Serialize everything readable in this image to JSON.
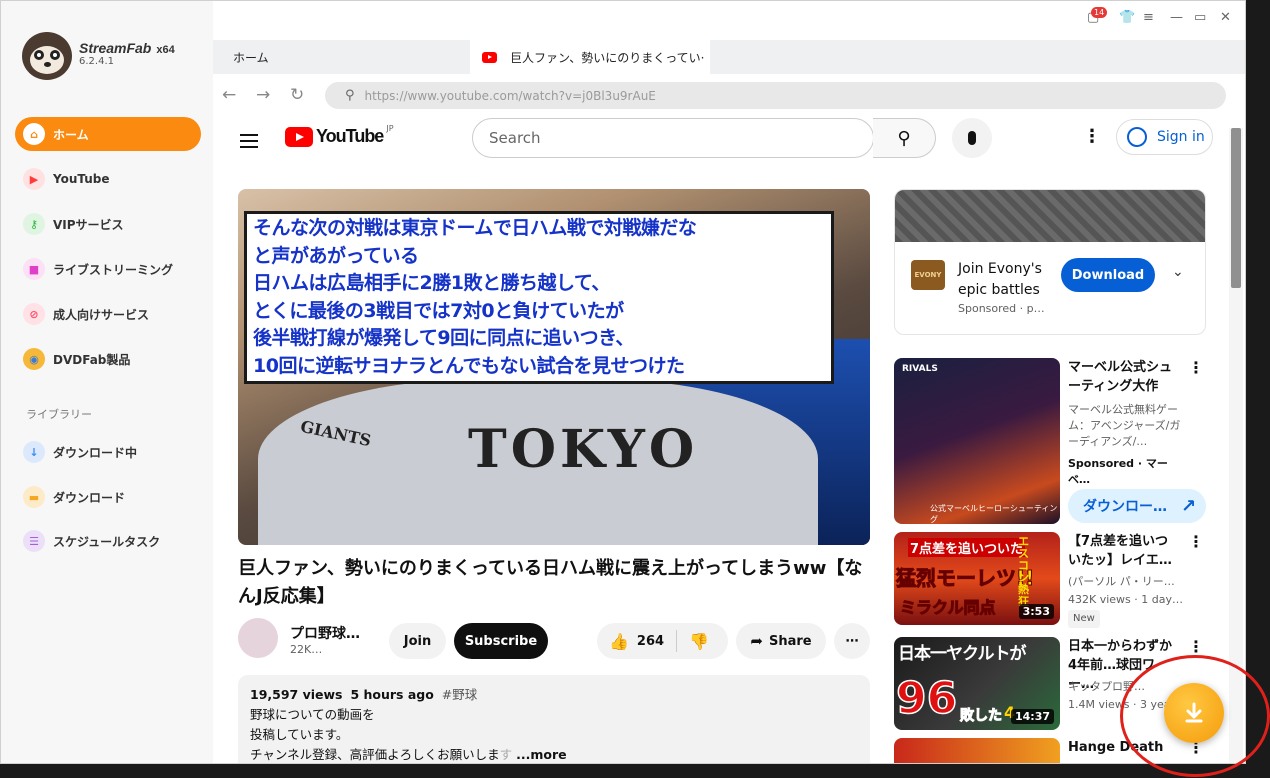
{
  "app": {
    "name": "StreamFab",
    "arch": "x64",
    "version": "6.2.4.1",
    "notif_count": "14"
  },
  "sidebar": {
    "items": [
      {
        "label": "ホーム",
        "icon": "home-icon",
        "color": "#fa8a10",
        "active": true
      },
      {
        "label": "YouTube",
        "icon": "youtube-icon",
        "color": "#ff5a5a"
      },
      {
        "label": "VIPサービス",
        "icon": "key-icon",
        "color": "#3cc24a"
      },
      {
        "label": "ライブストリーミング",
        "icon": "camera-icon",
        "color": "#e040c8"
      },
      {
        "label": "成人向けサービス",
        "icon": "adult-icon",
        "color": "#ff4f6a"
      },
      {
        "label": "DVDFab製品",
        "icon": "dvdfab-icon",
        "color": "#3a7bd5"
      }
    ],
    "library_label": "ライブラリー",
    "library": [
      {
        "label": "ダウンロード中",
        "icon": "download-icon",
        "color": "#3d8bf2"
      },
      {
        "label": "ダウンロード",
        "icon": "folder-icon",
        "color": "#f5a623"
      },
      {
        "label": "スケジュールタスク",
        "icon": "schedule-icon",
        "color": "#a35ed8"
      }
    ]
  },
  "tabs": {
    "home": "ホーム",
    "active": "巨人ファン、勢いにのりまくってい·"
  },
  "address": {
    "url": "https://www.youtube.com/watch?v=j0Bl3u9rAuE"
  },
  "youtube": {
    "logo_text": "YouTube",
    "region": "JP",
    "search_placeholder": "Search",
    "signin": "Sign in",
    "video": {
      "caption": [
        "そんな次の対戦は東京ドームで日ハム戦で対戦嫌だな",
        "と声があがっている",
        "日ハムは広島相手に2勝1敗と勝ち越して、",
        "とくに最後の3戦目では7対0と負けていたが",
        "後半戦打線が爆発して9回に同点に追いつき、",
        "10回に逆転サヨナラとんでもない試合を見せつけた"
      ],
      "jersey_text": "TOKYO",
      "jersey_giants": "GIANTS",
      "title": "巨人ファン、勢いにのりまくっている日ハム戦に震え上がってしまうww【なんJ反応集】",
      "channel": "プロ野球…",
      "subs": "22K…",
      "join": "Join",
      "subscribe": "Subscribe",
      "likes": "264",
      "share": "Share",
      "views": "19,597 views",
      "age": "5 hours ago",
      "hashtag": "#野球",
      "desc_lines": [
        "野球についての動画を",
        "投稿しています。",
        "チャンネル登録、高評価よろしくお願いしま"
      ],
      "desc_fade": "す",
      "more": "...more"
    },
    "ad": {
      "logo_text": "EVONY",
      "title": "Join Evony's epic battles",
      "sponsor": "Sponsored · p…",
      "button": "Download"
    },
    "related": [
      {
        "title": "マーベル公式シューティング大作",
        "channel": "マーベル公式無料ゲーム：アベンジャーズ/ガーディアンズ/…",
        "meta": "Sponsored · マーベ…",
        "button": "ダウンロー…",
        "thumb_label": "公式マーベルヒーローシューティング",
        "thumb_logo": "RIVALS"
      },
      {
        "title": "【7点差を追いついたッ】レイエ…",
        "channel": "(パーソル パ・リー…",
        "meta": "432K views · 1 day…",
        "badge": "New",
        "duration": "3:53",
        "thumb_caption": "7点差を追いついた",
        "thumb_big": "猛烈モーレツ!!",
        "thumb_sub": "ミラクル同点",
        "thumb_tag": "エスコン熱狂"
      },
      {
        "title": "日本一からわずか4年前…球団ワー…",
        "channel": "キッタプロ野…",
        "meta": "1.4M views · 3 yea…",
        "duration": "14:37",
        "thumb_caption": "日本一ヤクルトが",
        "thumb_big": "96",
        "thumb_sub": "敗した",
        "thumb_tag": "4"
      },
      {
        "title": "Hange Death",
        "channel": "",
        "meta": ""
      }
    ]
  }
}
